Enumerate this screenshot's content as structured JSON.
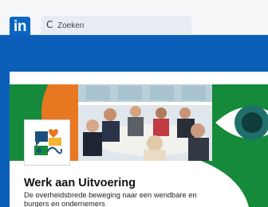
{
  "header": {
    "logo_text": "in",
    "search_placeholder": "Zoeken",
    "search_icon": "search-icon"
  },
  "page": {
    "title": "Werk aan Uitvoering",
    "description": "De overheidsbrede beweging naar een wendbare en",
    "description_line2": "burgers en ondernemers"
  },
  "colors": {
    "brand_blue": "#0a66c2",
    "band_blue": "#0b5fb8",
    "green": "#148a3a",
    "orange": "#e87722",
    "teal": "#1f6f6a"
  }
}
